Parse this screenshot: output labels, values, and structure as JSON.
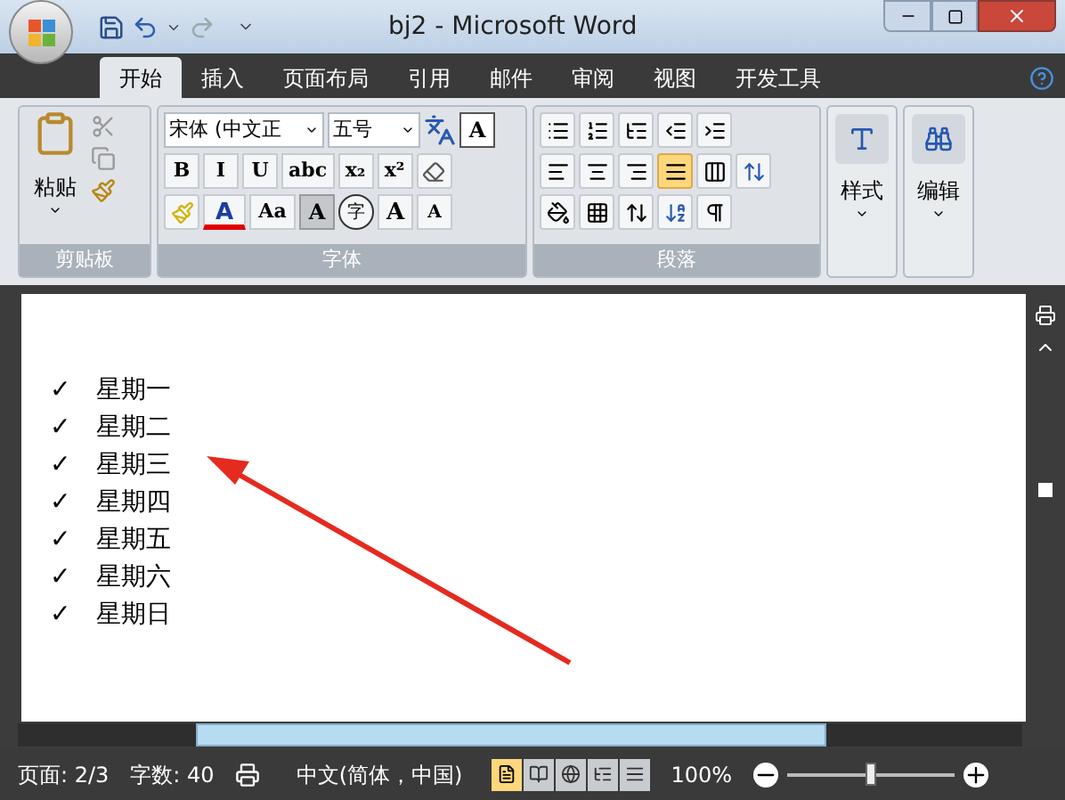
{
  "window": {
    "title": "bj2 - Microsoft Word"
  },
  "tabs": [
    {
      "label": "开始",
      "selected": true
    },
    {
      "label": "插入",
      "selected": false
    },
    {
      "label": "页面布局",
      "selected": false
    },
    {
      "label": "引用",
      "selected": false
    },
    {
      "label": "邮件",
      "selected": false
    },
    {
      "label": "审阅",
      "selected": false
    },
    {
      "label": "视图",
      "selected": false
    },
    {
      "label": "开发工具",
      "selected": false
    }
  ],
  "clipboard": {
    "paste": "粘贴",
    "label": "剪贴板"
  },
  "font": {
    "name": "宋体 (中文正",
    "size": "五号",
    "styles": [
      "B",
      "I",
      "U",
      "abc",
      "x₂",
      "x²"
    ],
    "grow": "A",
    "shrink": "A",
    "case": "Aa",
    "border_letter": "A",
    "shade": "A",
    "color_letter": "A",
    "encircle": "字",
    "label": "字体"
  },
  "paragraph": {
    "align": [
      {
        "selected": false
      },
      {
        "selected": false
      },
      {
        "selected": false
      },
      {
        "selected": true
      },
      {
        "selected": false
      }
    ],
    "label": "段落"
  },
  "styles": {
    "label": "样式"
  },
  "editing": {
    "label": "编辑"
  },
  "document": {
    "items": [
      {
        "mark": "✓",
        "text": "星期一"
      },
      {
        "mark": "✓",
        "text": "星期二"
      },
      {
        "mark": "✓",
        "text": "星期三"
      },
      {
        "mark": "✓",
        "text": "星期四"
      },
      {
        "mark": "✓",
        "text": "星期五"
      },
      {
        "mark": "✓",
        "text": "星期六"
      },
      {
        "mark": "✓",
        "text": "星期日"
      }
    ]
  },
  "status_bar": {
    "page": "页面: 2/3",
    "words": "字数: 40",
    "language": "中文(简体，中国)",
    "views": [
      {
        "selected": true
      },
      {
        "selected": false
      },
      {
        "selected": false
      },
      {
        "selected": false
      },
      {
        "selected": false
      }
    ],
    "zoom": "100%",
    "zoom_slider": {
      "level": 0.5
    }
  }
}
